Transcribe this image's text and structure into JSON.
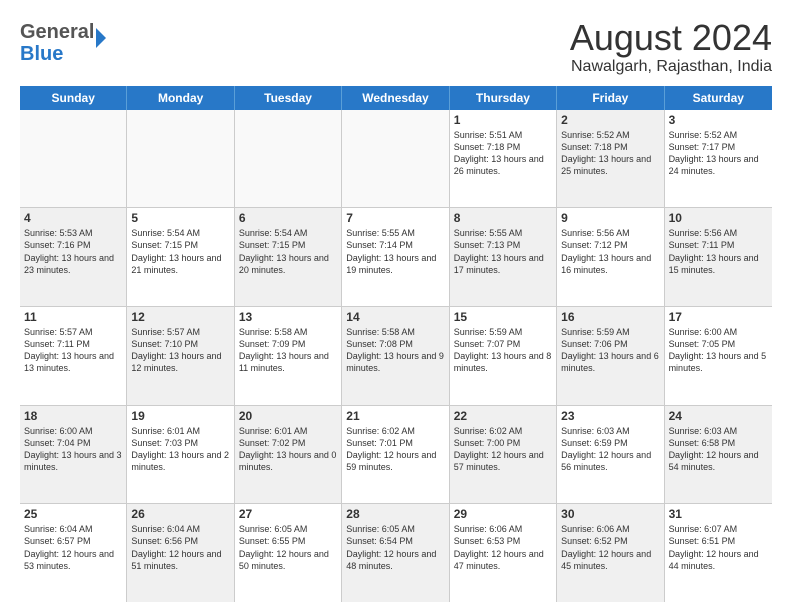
{
  "header": {
    "logo_general": "General",
    "logo_blue": "Blue",
    "month_year": "August 2024",
    "location": "Nawalgarh, Rajasthan, India"
  },
  "days_of_week": [
    "Sunday",
    "Monday",
    "Tuesday",
    "Wednesday",
    "Thursday",
    "Friday",
    "Saturday"
  ],
  "weeks": [
    [
      {
        "day": "",
        "sunrise": "",
        "sunset": "",
        "daylight": "",
        "shaded": false
      },
      {
        "day": "",
        "sunrise": "",
        "sunset": "",
        "daylight": "",
        "shaded": false
      },
      {
        "day": "",
        "sunrise": "",
        "sunset": "",
        "daylight": "",
        "shaded": false
      },
      {
        "day": "",
        "sunrise": "",
        "sunset": "",
        "daylight": "",
        "shaded": false
      },
      {
        "day": "1",
        "sunrise": "Sunrise: 5:51 AM",
        "sunset": "Sunset: 7:18 PM",
        "daylight": "Daylight: 13 hours and 26 minutes.",
        "shaded": false
      },
      {
        "day": "2",
        "sunrise": "Sunrise: 5:52 AM",
        "sunset": "Sunset: 7:18 PM",
        "daylight": "Daylight: 13 hours and 25 minutes.",
        "shaded": true
      },
      {
        "day": "3",
        "sunrise": "Sunrise: 5:52 AM",
        "sunset": "Sunset: 7:17 PM",
        "daylight": "Daylight: 13 hours and 24 minutes.",
        "shaded": false
      }
    ],
    [
      {
        "day": "4",
        "sunrise": "Sunrise: 5:53 AM",
        "sunset": "Sunset: 7:16 PM",
        "daylight": "Daylight: 13 hours and 23 minutes.",
        "shaded": true
      },
      {
        "day": "5",
        "sunrise": "Sunrise: 5:54 AM",
        "sunset": "Sunset: 7:15 PM",
        "daylight": "Daylight: 13 hours and 21 minutes.",
        "shaded": false
      },
      {
        "day": "6",
        "sunrise": "Sunrise: 5:54 AM",
        "sunset": "Sunset: 7:15 PM",
        "daylight": "Daylight: 13 hours and 20 minutes.",
        "shaded": true
      },
      {
        "day": "7",
        "sunrise": "Sunrise: 5:55 AM",
        "sunset": "Sunset: 7:14 PM",
        "daylight": "Daylight: 13 hours and 19 minutes.",
        "shaded": false
      },
      {
        "day": "8",
        "sunrise": "Sunrise: 5:55 AM",
        "sunset": "Sunset: 7:13 PM",
        "daylight": "Daylight: 13 hours and 17 minutes.",
        "shaded": true
      },
      {
        "day": "9",
        "sunrise": "Sunrise: 5:56 AM",
        "sunset": "Sunset: 7:12 PM",
        "daylight": "Daylight: 13 hours and 16 minutes.",
        "shaded": false
      },
      {
        "day": "10",
        "sunrise": "Sunrise: 5:56 AM",
        "sunset": "Sunset: 7:11 PM",
        "daylight": "Daylight: 13 hours and 15 minutes.",
        "shaded": true
      }
    ],
    [
      {
        "day": "11",
        "sunrise": "Sunrise: 5:57 AM",
        "sunset": "Sunset: 7:11 PM",
        "daylight": "Daylight: 13 hours and 13 minutes.",
        "shaded": false
      },
      {
        "day": "12",
        "sunrise": "Sunrise: 5:57 AM",
        "sunset": "Sunset: 7:10 PM",
        "daylight": "Daylight: 13 hours and 12 minutes.",
        "shaded": true
      },
      {
        "day": "13",
        "sunrise": "Sunrise: 5:58 AM",
        "sunset": "Sunset: 7:09 PM",
        "daylight": "Daylight: 13 hours and 11 minutes.",
        "shaded": false
      },
      {
        "day": "14",
        "sunrise": "Sunrise: 5:58 AM",
        "sunset": "Sunset: 7:08 PM",
        "daylight": "Daylight: 13 hours and 9 minutes.",
        "shaded": true
      },
      {
        "day": "15",
        "sunrise": "Sunrise: 5:59 AM",
        "sunset": "Sunset: 7:07 PM",
        "daylight": "Daylight: 13 hours and 8 minutes.",
        "shaded": false
      },
      {
        "day": "16",
        "sunrise": "Sunrise: 5:59 AM",
        "sunset": "Sunset: 7:06 PM",
        "daylight": "Daylight: 13 hours and 6 minutes.",
        "shaded": true
      },
      {
        "day": "17",
        "sunrise": "Sunrise: 6:00 AM",
        "sunset": "Sunset: 7:05 PM",
        "daylight": "Daylight: 13 hours and 5 minutes.",
        "shaded": false
      }
    ],
    [
      {
        "day": "18",
        "sunrise": "Sunrise: 6:00 AM",
        "sunset": "Sunset: 7:04 PM",
        "daylight": "Daylight: 13 hours and 3 minutes.",
        "shaded": true
      },
      {
        "day": "19",
        "sunrise": "Sunrise: 6:01 AM",
        "sunset": "Sunset: 7:03 PM",
        "daylight": "Daylight: 13 hours and 2 minutes.",
        "shaded": false
      },
      {
        "day": "20",
        "sunrise": "Sunrise: 6:01 AM",
        "sunset": "Sunset: 7:02 PM",
        "daylight": "Daylight: 13 hours and 0 minutes.",
        "shaded": true
      },
      {
        "day": "21",
        "sunrise": "Sunrise: 6:02 AM",
        "sunset": "Sunset: 7:01 PM",
        "daylight": "Daylight: 12 hours and 59 minutes.",
        "shaded": false
      },
      {
        "day": "22",
        "sunrise": "Sunrise: 6:02 AM",
        "sunset": "Sunset: 7:00 PM",
        "daylight": "Daylight: 12 hours and 57 minutes.",
        "shaded": true
      },
      {
        "day": "23",
        "sunrise": "Sunrise: 6:03 AM",
        "sunset": "Sunset: 6:59 PM",
        "daylight": "Daylight: 12 hours and 56 minutes.",
        "shaded": false
      },
      {
        "day": "24",
        "sunrise": "Sunrise: 6:03 AM",
        "sunset": "Sunset: 6:58 PM",
        "daylight": "Daylight: 12 hours and 54 minutes.",
        "shaded": true
      }
    ],
    [
      {
        "day": "25",
        "sunrise": "Sunrise: 6:04 AM",
        "sunset": "Sunset: 6:57 PM",
        "daylight": "Daylight: 12 hours and 53 minutes.",
        "shaded": false
      },
      {
        "day": "26",
        "sunrise": "Sunrise: 6:04 AM",
        "sunset": "Sunset: 6:56 PM",
        "daylight": "Daylight: 12 hours and 51 minutes.",
        "shaded": true
      },
      {
        "day": "27",
        "sunrise": "Sunrise: 6:05 AM",
        "sunset": "Sunset: 6:55 PM",
        "daylight": "Daylight: 12 hours and 50 minutes.",
        "shaded": false
      },
      {
        "day": "28",
        "sunrise": "Sunrise: 6:05 AM",
        "sunset": "Sunset: 6:54 PM",
        "daylight": "Daylight: 12 hours and 48 minutes.",
        "shaded": true
      },
      {
        "day": "29",
        "sunrise": "Sunrise: 6:06 AM",
        "sunset": "Sunset: 6:53 PM",
        "daylight": "Daylight: 12 hours and 47 minutes.",
        "shaded": false
      },
      {
        "day": "30",
        "sunrise": "Sunrise: 6:06 AM",
        "sunset": "Sunset: 6:52 PM",
        "daylight": "Daylight: 12 hours and 45 minutes.",
        "shaded": true
      },
      {
        "day": "31",
        "sunrise": "Sunrise: 6:07 AM",
        "sunset": "Sunset: 6:51 PM",
        "daylight": "Daylight: 12 hours and 44 minutes.",
        "shaded": false
      }
    ]
  ]
}
